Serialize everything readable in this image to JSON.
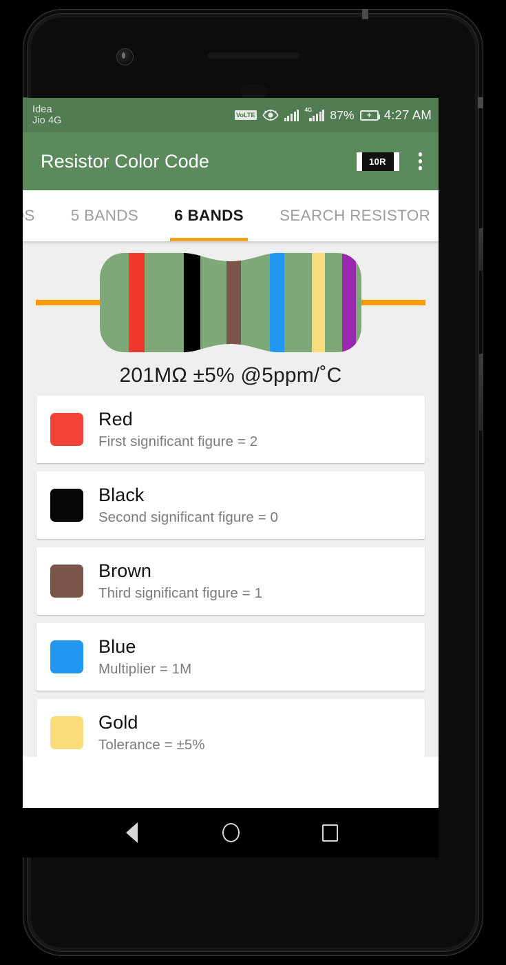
{
  "device": {
    "camera_icon": "front-camera",
    "earpiece_icon": "earpiece-speaker",
    "sensor_icon": "proximity-sensor"
  },
  "status_bar": {
    "carrier_1": "Idea",
    "carrier_2": "Jio 4G",
    "volte_label": "VoLTE",
    "eye_icon": "eye-icon",
    "signal_icon": "signal-bars-icon",
    "network_label": "4G",
    "battery_percent": "87%",
    "battery_icon": "battery-charging-icon",
    "charging_glyph": "+",
    "clock": "4:27 AM",
    "background_color": "#517c52"
  },
  "app_bar": {
    "title": "Resistor Color Code",
    "smd_icon_label": "10R",
    "smd_icon_name": "smd-resistor-icon",
    "overflow_icon": "overflow-menu-icon",
    "background_color": "#5b8a5c"
  },
  "tabs": {
    "items": [
      {
        "label": "ANDS",
        "active": false
      },
      {
        "label": "5 BANDS",
        "active": false
      },
      {
        "label": "6 BANDS",
        "active": true
      },
      {
        "label": "SEARCH RESISTOR",
        "active": false
      }
    ],
    "indicator_color": "#f5a11b",
    "active_color": "#1a1a1a",
    "inactive_color": "#9e9e9e"
  },
  "resistor": {
    "body_color": "#7fa878",
    "lead_color": "#fb9a05",
    "bands": [
      {
        "name": "Red",
        "color": "#f0392b",
        "left_pct": 11.0,
        "width_pct": 6.0
      },
      {
        "name": "Black",
        "color": "#000000",
        "left_pct": 32.0,
        "width_pct": 6.5
      },
      {
        "name": "Brown",
        "color": "#7b5548",
        "left_pct": 48.5,
        "width_pct": 5.5
      },
      {
        "name": "Blue",
        "color": "#2196f3",
        "left_pct": 65.0,
        "width_pct": 5.5
      },
      {
        "name": "Gold",
        "color": "#fbdc7b",
        "left_pct": 81.0,
        "width_pct": 5.0
      },
      {
        "name": "Violet",
        "color": "#9c27b0",
        "left_pct": 92.5,
        "width_pct": 5.5
      }
    ],
    "value_text": "201MΩ ±5% @5ppm/˚C"
  },
  "bands_list": [
    {
      "color_name": "Red",
      "swatch": "#f4433a",
      "description": "First significant figure = 2"
    },
    {
      "color_name": "Black",
      "swatch": "#060606",
      "description": "Second significant figure = 0"
    },
    {
      "color_name": "Brown",
      "swatch": "#7b5548",
      "description": "Third significant figure = 1"
    },
    {
      "color_name": "Blue",
      "swatch": "#2196f3",
      "description": "Multiplier = 1M"
    },
    {
      "color_name": "Gold",
      "swatch": "#fbdc7b",
      "description": "Tolerance = ±5%"
    }
  ],
  "nav_bar": {
    "back_icon": "back-triangle-icon",
    "home_icon": "home-circle-icon",
    "recents_icon": "recents-square-icon"
  }
}
